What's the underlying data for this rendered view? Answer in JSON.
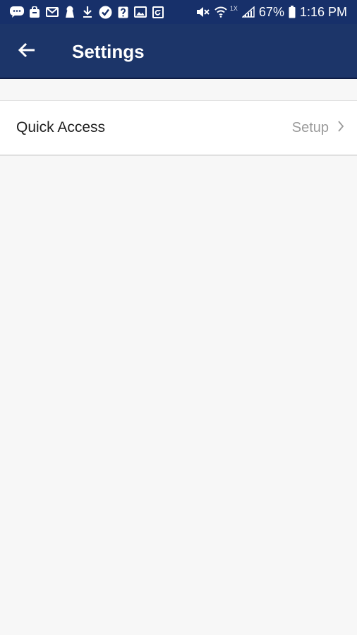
{
  "status_bar": {
    "notification_icons": [
      "messages-icon",
      "store-icon",
      "gmail-icon",
      "keyhole-icon",
      "download-icon",
      "check-circle-icon",
      "help-icon",
      "image-icon",
      "calendar-refresh-icon"
    ],
    "network_label": "1X",
    "battery_percent": "67%",
    "time": "1:16 PM"
  },
  "app_bar": {
    "title": "Settings",
    "background_color": "#1c3569"
  },
  "settings": {
    "items": [
      {
        "label": "Quick Access",
        "value": "Setup"
      }
    ]
  }
}
